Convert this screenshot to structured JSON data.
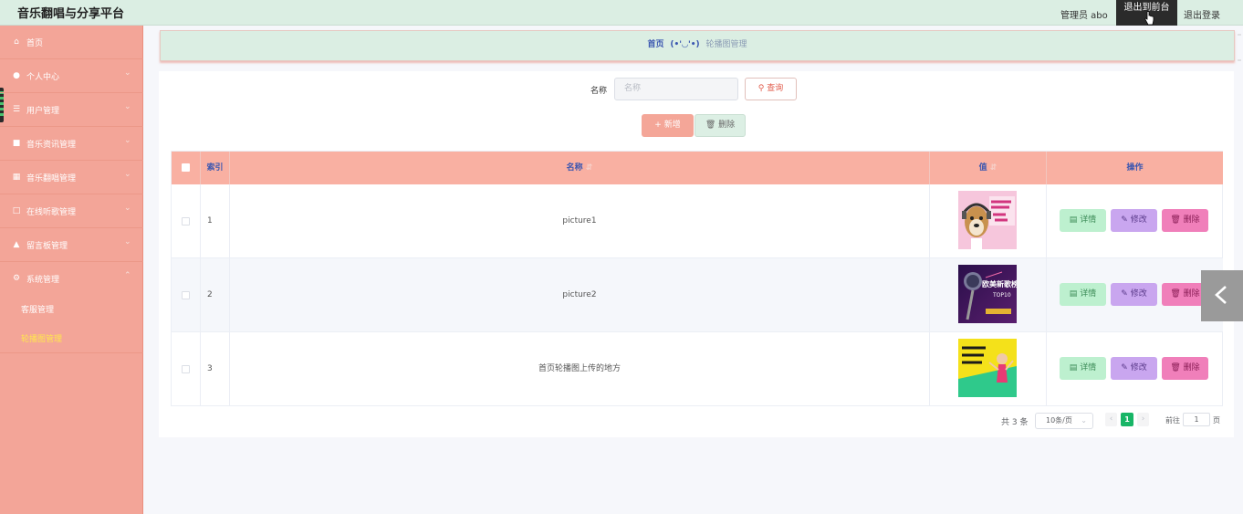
{
  "app": {
    "title": "音乐翻唱与分享平台"
  },
  "header": {
    "admin_label": "管理员 abo",
    "to_front_label": "退出到前台",
    "logout_label": "退出登录"
  },
  "sidebar": {
    "items": [
      {
        "label": "首页",
        "icon": "home-icon",
        "has_chevron": false
      },
      {
        "label": "个人中心",
        "icon": "user-icon",
        "has_chevron": true
      },
      {
        "label": "用户管理",
        "icon": "list-icon",
        "has_chevron": true
      },
      {
        "label": "音乐资讯管理",
        "icon": "video-icon",
        "has_chevron": true
      },
      {
        "label": "音乐翻唱管理",
        "icon": "grid-icon",
        "has_chevron": true
      },
      {
        "label": "在线听歌管理",
        "icon": "fullscreen-icon",
        "has_chevron": true
      },
      {
        "label": "留言板管理",
        "icon": "person-icon",
        "has_chevron": true
      },
      {
        "label": "系统管理",
        "icon": "gear-icon",
        "has_chevron": true,
        "expanded": true
      }
    ],
    "sub_items": [
      {
        "label": "客服管理",
        "active": false
      },
      {
        "label": "轮播图管理",
        "active": true
      }
    ]
  },
  "breadcrumb": {
    "home": "首页",
    "separator": "(•'◡'•)",
    "current": "轮播图管理"
  },
  "search": {
    "label": "名称",
    "placeholder": "名称",
    "query_label": "查询"
  },
  "actions": {
    "add_label": "新增",
    "delete_label": "删除"
  },
  "table": {
    "columns": [
      "索引",
      "名称",
      "值",
      "操作"
    ],
    "rows": [
      {
        "index": "1",
        "name": "picture1"
      },
      {
        "index": "2",
        "name": "picture2"
      },
      {
        "index": "3",
        "name": "首页轮播图上传的地方"
      }
    ],
    "row_actions": {
      "detail": "详情",
      "edit": "修改",
      "delete": "删除"
    }
  },
  "pagination": {
    "total": "共 3 条",
    "page_size": "10条/页",
    "current_page": "1",
    "goto_label": "前往",
    "goto_value": "1",
    "unit": "页"
  },
  "thumbnails": {
    "picture2_title": "欧美新歌榜",
    "picture2_sub": "TOP10"
  },
  "colors": {
    "sidebar_bg": "#f3a598",
    "header_bg": "#dbeee3",
    "active_sub": "#ffe74d",
    "pager_active": "#18b566"
  }
}
